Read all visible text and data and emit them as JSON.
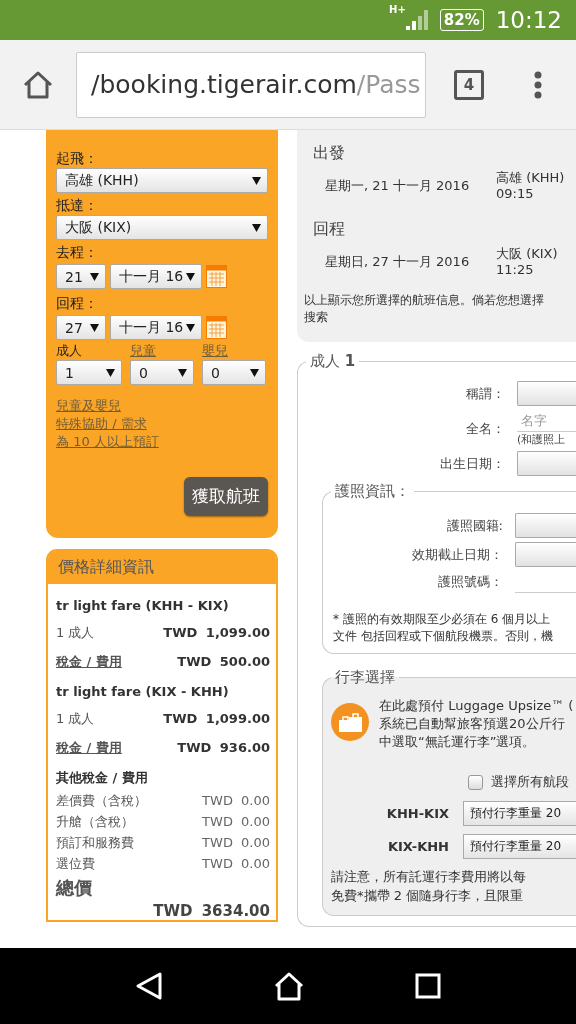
{
  "status_bar": {
    "network": "H+",
    "battery": "82%",
    "time": "10:12"
  },
  "browser": {
    "url_host": "/booking.tigerair.com",
    "url_path": "/Pass",
    "tab_count": "4"
  },
  "search_form": {
    "origin": {
      "label": "起飛：",
      "value": "高雄 (KHH)"
    },
    "destination": {
      "label": "抵達：",
      "value": "大阪 (KIX)"
    },
    "depart": {
      "label": "去程：",
      "day": "21",
      "month": "十一月 16"
    },
    "return": {
      "label": "回程：",
      "day": "27",
      "month": "十一月 16"
    },
    "passengers": [
      {
        "label": "成人",
        "value": "1",
        "link": false
      },
      {
        "label": "兒童",
        "value": "0",
        "link": true
      },
      {
        "label": "嬰兒",
        "value": "0",
        "link": true
      }
    ],
    "links": [
      "兒童及嬰兒",
      "特殊協助 / 需求",
      "為 10 人以上預訂"
    ],
    "submit": "獲取航班"
  },
  "price_details": {
    "title": "價格詳細資訊",
    "sections": [
      {
        "title": "tr light fare (KHH - KIX)",
        "rows": [
          {
            "label": "1 成人",
            "amount": "TWD 1,099.00",
            "kind": "plain"
          },
          {
            "label": "稅金 / 費用",
            "amount": "TWD 500.00",
            "kind": "link"
          }
        ]
      },
      {
        "title": "tr light fare (KIX - KHH)",
        "rows": [
          {
            "label": "1 成人",
            "amount": "TWD 1,099.00",
            "kind": "plain"
          },
          {
            "label": "稅金 / 費用",
            "amount": "TWD 936.00",
            "kind": "link"
          }
        ]
      },
      {
        "title": "其他稅金 / 費用",
        "rows": [
          {
            "label": "差價費（含稅）",
            "amount": "TWD 0.00",
            "kind": "minor"
          },
          {
            "label": "升艙（含稅）",
            "amount": "TWD 0.00",
            "kind": "minor"
          },
          {
            "label": "預訂和服務費",
            "amount": "TWD 0.00",
            "kind": "minor"
          },
          {
            "label": "選位費",
            "amount": "TWD 0.00",
            "kind": "minor"
          }
        ]
      }
    ],
    "total_label": "總價",
    "total": "TWD 3634.00"
  },
  "flight_summary": {
    "legs": [
      {
        "heading": "出發",
        "date": "星期一, 21 十一月 2016",
        "place": "高雄 (KHH)",
        "time": "09:15"
      },
      {
        "heading": "回程",
        "date": "星期日, 27 十一月 2016",
        "place": "大阪 (KIX)",
        "time": "11:25"
      }
    ],
    "note": [
      "以上顯示您所選擇的航班信息。倘若您想選擇",
      "搜索"
    ]
  },
  "passenger": {
    "legend": "成人 **1**",
    "fields": [
      {
        "label": "稱謂：",
        "kind": "select"
      },
      {
        "label": "全名：",
        "kind": "input",
        "placeholder": "名字",
        "hint": "(和護照上"
      },
      {
        "label": "出生日期：",
        "kind": "select"
      }
    ],
    "passport": {
      "legend": "護照資訊：",
      "fields": [
        {
          "label": "護照國籍:",
          "kind": "select"
        },
        {
          "label": "效期截止日期：",
          "kind": "select"
        },
        {
          "label": "護照號碼：",
          "kind": "input"
        }
      ],
      "note": [
        "* 護照的有效期限至少必須在 6 個月以上",
        "文件 包括回程或下個航段機票。否則，機"
      ]
    }
  },
  "luggage": {
    "legend": "行李選擇",
    "intro": [
      "在此處預付 Luggage Upsize™ (",
      "系統已自動幫旅客預選20公斤行",
      "中選取“無託運行李”選項。"
    ],
    "select_all": {
      "label": "選擇所有航段",
      "checked": false
    },
    "segments": [
      {
        "route": "KHH-KIX",
        "value": "預付行李重量 20"
      },
      {
        "route": "KIX-KHH",
        "value": "預付行李重量 20"
      }
    ],
    "note": [
      "請注意，所有託運行李費用將以每",
      "免費*攜帶 2 個隨身行李，且限重"
    ]
  }
}
